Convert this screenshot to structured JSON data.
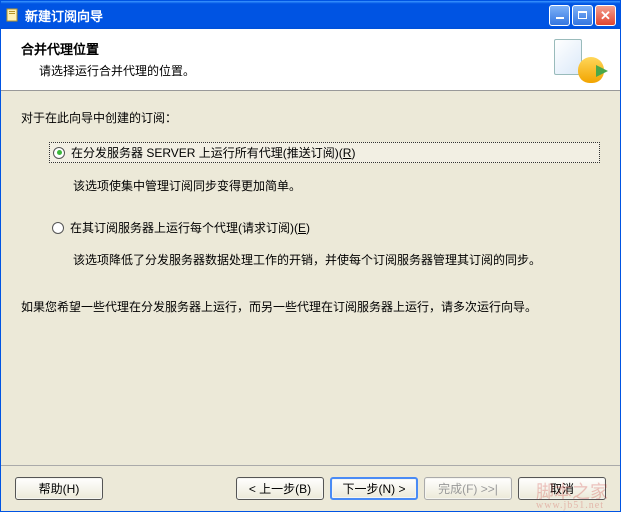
{
  "titlebar": {
    "title": "新建订阅向导"
  },
  "header": {
    "title": "合并代理位置",
    "subtitle": "请选择运行合并代理的位置。"
  },
  "content": {
    "intro": "对于在此向导中创建的订阅：",
    "option1": {
      "label_pre": "在分发服务器 SERVER 上运行所有代理(推送订阅)(",
      "accel": "R",
      "label_post": ")",
      "desc": "该选项使集中管理订阅同步变得更加简单。",
      "checked": true
    },
    "option2": {
      "label_pre": "在其订阅服务器上运行每个代理(请求订阅)(",
      "accel": "E",
      "label_post": ")",
      "desc": "该选项降低了分发服务器数据处理工作的开销，并使每个订阅服务器管理其订阅的同步。",
      "checked": false
    },
    "note": "如果您希望一些代理在分发服务器上运行，而另一些代理在订阅服务器上运行，请多次运行向导。"
  },
  "footer": {
    "help": "帮助(H)",
    "back": "< 上一步(B)",
    "next": "下一步(N) >",
    "finish": "完成(F) >>|",
    "cancel": "取消"
  },
  "watermark": {
    "main": "脚本之家",
    "sub": "www.jb51.net"
  }
}
